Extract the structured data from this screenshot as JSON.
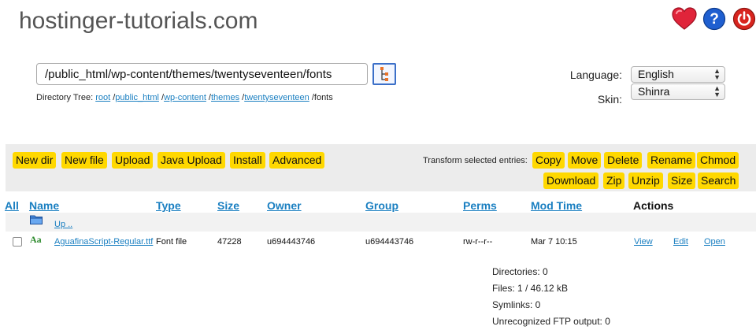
{
  "header": {
    "site_title": "hostinger-tutorials.com",
    "icons": [
      "heart-icon",
      "help-icon",
      "power-icon"
    ]
  },
  "browse": {
    "path_value": "/public_html/wp-content/themes/twentyseventeen/fonts",
    "tree_label": "Directory Tree:",
    "tree": [
      "root",
      "public_html",
      "wp-content",
      "themes",
      "twentyseventeen"
    ],
    "tree_current": "fonts"
  },
  "settings": {
    "language_label": "Language:",
    "language_value": "English",
    "skin_label": "Skin:",
    "skin_value": "Shinra"
  },
  "toolbar": {
    "left_buttons": [
      "New dir",
      "New file",
      "Upload",
      "Java Upload",
      "Install",
      "Advanced"
    ],
    "transform_label": "Transform selected entries:",
    "right_row1": [
      "Copy",
      "Move",
      "Delete",
      "Rename",
      "Chmod"
    ],
    "right_row2": [
      "Download",
      "Zip",
      "Unzip",
      "Size",
      "Search"
    ]
  },
  "table": {
    "headers": {
      "all": "All",
      "name": "Name",
      "type": "Type",
      "size": "Size",
      "owner": "Owner",
      "group": "Group",
      "perms": "Perms",
      "mod_time": "Mod Time",
      "actions": "Actions"
    },
    "up_label": "Up ..",
    "rows": [
      {
        "name": "AguafinaScript-Regular.ttf",
        "type": "Font file",
        "size": "47228",
        "owner": "u694443746",
        "group": "u694443746",
        "perms": "rw-r--r--",
        "mod_time": "Mar 7 10:15",
        "view": "View",
        "edit": "Edit",
        "open": "Open"
      }
    ]
  },
  "stats": {
    "directories": "Directories: 0",
    "files": "Files: 1 / 46.12 kB",
    "symlinks": "Symlinks: 0",
    "unrecognized": "Unrecognized FTP output: 0"
  },
  "colors": {
    "button": "#ffd800",
    "link": "#1a7fc1",
    "toolbar_bg": "#ececec"
  }
}
